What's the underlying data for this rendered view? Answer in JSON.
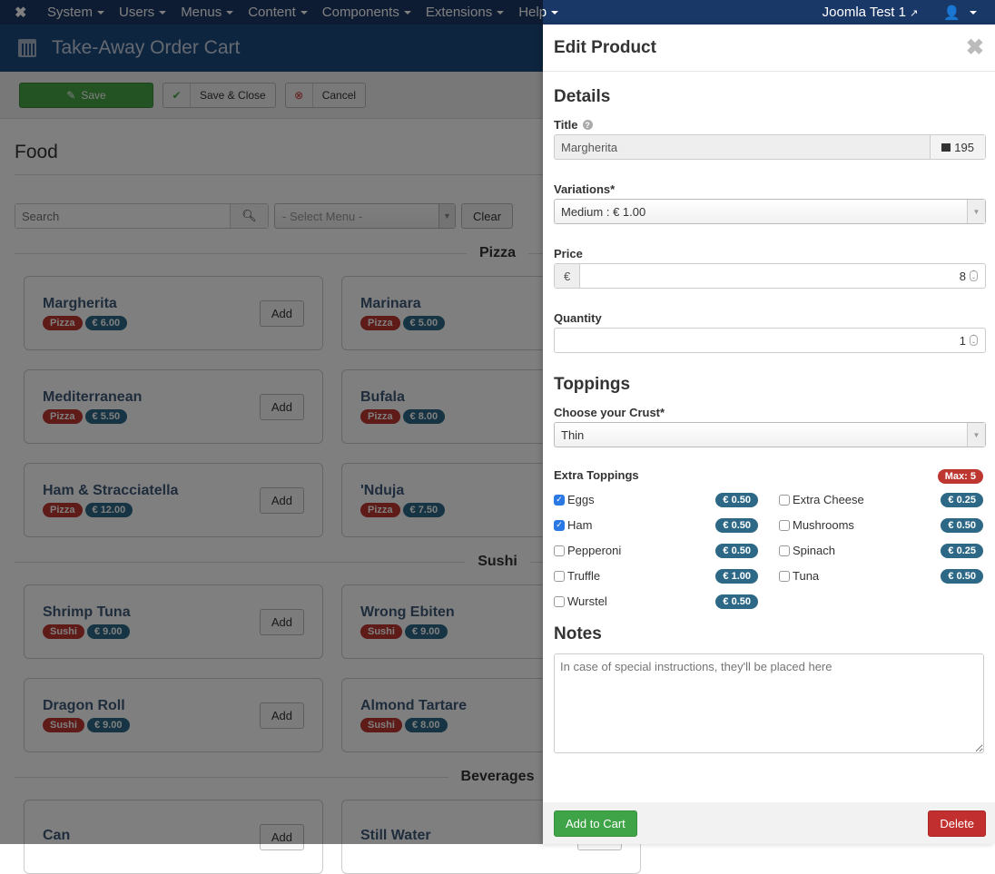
{
  "topnav": {
    "menus": [
      "System",
      "Users",
      "Menus",
      "Content",
      "Components",
      "Extensions",
      "Help"
    ],
    "site_label": "Joomla Test 1"
  },
  "page_title": "Take-Away Order Cart",
  "toolbar": {
    "save_label": "Save",
    "save_close_label": "Save & Close",
    "cancel_label": "Cancel"
  },
  "main": {
    "heading": "Food",
    "search_placeholder": "Search",
    "select_menu": "- Select Menu -",
    "clear_label": "Clear",
    "add_label": "Add",
    "sections": [
      {
        "name": "Pizza",
        "items": [
          {
            "name": "Margherita",
            "tag": "Pizza",
            "price": "€ 6.00"
          },
          {
            "name": "Marinara",
            "tag": "Pizza",
            "price": "€ 5.00"
          },
          {
            "name": "Mediterranean",
            "tag": "Pizza",
            "price": "€ 5.50"
          },
          {
            "name": "Bufala",
            "tag": "Pizza",
            "price": "€ 8.00"
          },
          {
            "name": "Ham & Stracciatella",
            "tag": "Pizza",
            "price": "€ 12.00"
          },
          {
            "name": "'Nduja",
            "tag": "Pizza",
            "price": "€ 7.50"
          }
        ]
      },
      {
        "name": "Sushi",
        "items": [
          {
            "name": "Shrimp Tuna",
            "tag": "Sushi",
            "price": "€ 9.00"
          },
          {
            "name": "Wrong Ebiten",
            "tag": "Sushi",
            "price": "€ 9.00"
          },
          {
            "name": "Dragon Roll",
            "tag": "Sushi",
            "price": "€ 9.00"
          },
          {
            "name": "Almond Tartare",
            "tag": "Sushi",
            "price": "€ 8.00"
          }
        ]
      },
      {
        "name": "Beverages",
        "items": [
          {
            "name": "Can",
            "tag": "",
            "price": ""
          },
          {
            "name": "Still Water",
            "tag": "",
            "price": ""
          }
        ]
      }
    ]
  },
  "panel": {
    "title": "Edit Product",
    "details_heading": "Details",
    "title_label": "Title",
    "title_value": "Margherita",
    "title_count": "195",
    "variations_label": "Variations*",
    "variations_value": "Medium : € 1.00",
    "price_label": "Price",
    "currency": "€",
    "price_value": "8",
    "quantity_label": "Quantity",
    "quantity_value": "1",
    "toppings_heading": "Toppings",
    "crust_label": "Choose your Crust*",
    "crust_value": "Thin",
    "extra_label": "Extra Toppings",
    "max_badge": "Max: 5",
    "toppings": [
      {
        "name": "Eggs",
        "price": "€ 0.50",
        "checked": true
      },
      {
        "name": "Extra Cheese",
        "price": "€ 0.25",
        "checked": false
      },
      {
        "name": "Ham",
        "price": "€ 0.50",
        "checked": true
      },
      {
        "name": "Mushrooms",
        "price": "€ 0.50",
        "checked": false
      },
      {
        "name": "Pepperoni",
        "price": "€ 0.50",
        "checked": false
      },
      {
        "name": "Spinach",
        "price": "€ 0.25",
        "checked": false
      },
      {
        "name": "Truffle",
        "price": "€ 1.00",
        "checked": false
      },
      {
        "name": "Tuna",
        "price": "€ 0.50",
        "checked": false
      },
      {
        "name": "Wurstel",
        "price": "€ 0.50",
        "checked": false
      }
    ],
    "notes_heading": "Notes",
    "notes_placeholder": "In case of special instructions, they'll be placed here",
    "add_to_cart_label": "Add to Cart",
    "delete_label": "Delete"
  }
}
